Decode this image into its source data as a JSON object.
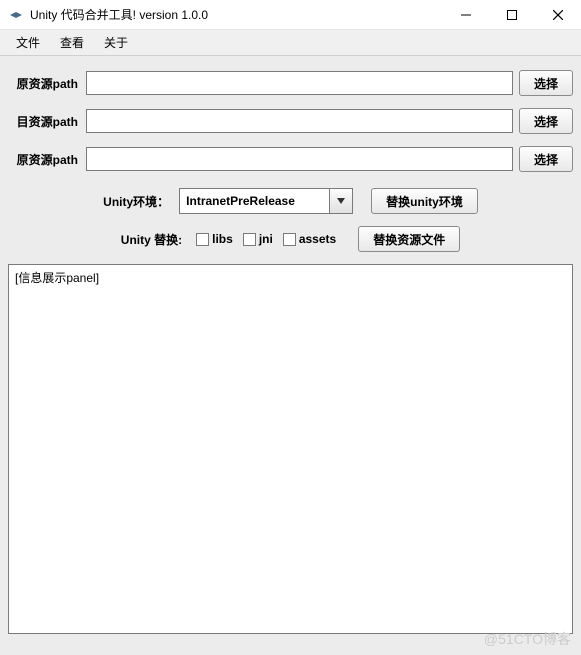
{
  "window": {
    "title": "Unity 代码合并工具! version 1.0.0"
  },
  "menu": {
    "file": "文件",
    "view": "查看",
    "about": "关于"
  },
  "paths": {
    "src_label": "原资源path",
    "dst_label": "目资源path",
    "src2_label": "原资源path",
    "src_value": "",
    "dst_value": "",
    "src2_value": "",
    "choose": "选择"
  },
  "env": {
    "label": "Unity环境：",
    "selected": "IntranetPreRelease",
    "replace_btn": "替换unity环境"
  },
  "replace": {
    "label": "Unity  替换:",
    "libs": "libs",
    "jni": "jni",
    "assets": "assets",
    "btn": "替换资源文件"
  },
  "info_panel": {
    "placeholder": "[信息展示panel]"
  },
  "watermark": "@51CTO博客"
}
